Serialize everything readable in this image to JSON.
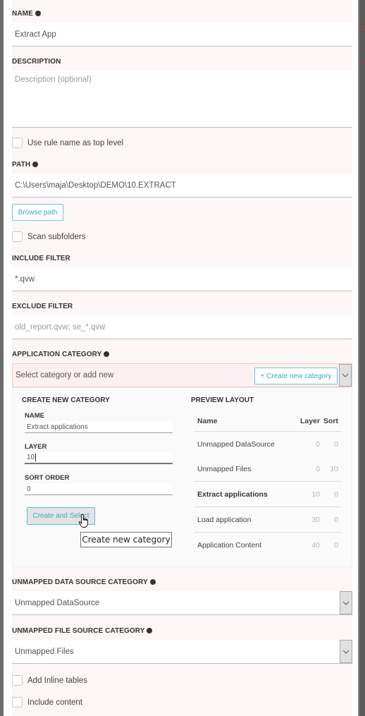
{
  "form": {
    "name": {
      "label": "NAME",
      "required": true,
      "value": "Extract App"
    },
    "description": {
      "label": "DESCRIPTION",
      "placeholder": "Description (optional)"
    },
    "use_rule_name": {
      "label": "Use rule name as top level",
      "checked": false
    },
    "path": {
      "label": "PATH",
      "required": true,
      "value": "C:\\Users\\maja\\Desktop\\DEMO\\10.EXTRACT",
      "browse_label": "Browse path"
    },
    "scan_subfolders": {
      "label": "Scan subfolders",
      "checked": false
    },
    "include_filter": {
      "label": "INCLUDE FILTER",
      "value": "*.qvw"
    },
    "exclude_filter": {
      "label": "EXCLUDE FILTER",
      "placeholder": "old_report.qvw; se_*.qvw"
    },
    "application_category": {
      "label": "APPLICATION CATEGORY",
      "required": true,
      "placeholder": "Select category or add new",
      "create_button_label": "+ Create new category"
    },
    "create_category": {
      "title": "CREATE NEW CATEGORY",
      "name": {
        "label": "NAME",
        "value": "Extract applications"
      },
      "layer": {
        "label": "LAYER",
        "value": "10"
      },
      "sort_order": {
        "label": "SORT ORDER",
        "value": "0"
      },
      "submit_label": "Create and Select",
      "tooltip": "Create new category"
    },
    "preview_layout": {
      "title": "PREVIEW LAYOUT",
      "columns": [
        "Name",
        "Layer",
        "Sort"
      ],
      "rows": [
        {
          "name": "Unmapped DataSource",
          "layer": "0",
          "sort": "0",
          "highlight": false
        },
        {
          "name": "Unmapped Files",
          "layer": "0",
          "sort": "10",
          "highlight": false
        },
        {
          "name": "Extract applications",
          "layer": "10",
          "sort": "0",
          "highlight": true
        },
        {
          "name": "Load application",
          "layer": "30",
          "sort": "0",
          "highlight": false
        },
        {
          "name": "Application Content",
          "layer": "40",
          "sort": "0",
          "highlight": false
        }
      ]
    },
    "unmapped_data_source": {
      "label": "UNMAPPED DATA SOURCE CATEGORY",
      "required": true,
      "value": "Unmapped DataSource"
    },
    "unmapped_file_source": {
      "label": "UNMAPPED FILE SOURCE CATEGORY",
      "required": true,
      "value": "Unmapped Files"
    },
    "add_inline_tables": {
      "label": "Add Inline tables",
      "checked": false
    },
    "include_content": {
      "label": "Include content",
      "checked": false
    }
  },
  "colors": {
    "accent": "#3aa8c8",
    "form_bg": "#fdf6f6",
    "category_select_bg": "#fdf0f0"
  }
}
